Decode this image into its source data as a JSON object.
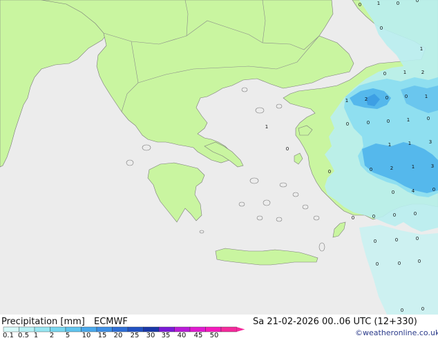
{
  "map": {
    "colors": {
      "sea": "#ececec",
      "land": "#c9f5a0",
      "border": "#8a8a8a",
      "coast": "#6a6a6a",
      "precip_light": "#b9eef0",
      "precip_mid": "#8fdff0",
      "precip_heavy": "#55b8ec"
    },
    "point_values": [
      {
        "v": "0"
      },
      {
        "v": "1"
      },
      {
        "v": "0"
      },
      {
        "v": "0"
      },
      {
        "v": "0"
      },
      {
        "v": "1"
      },
      {
        "v": "0"
      },
      {
        "v": "1"
      },
      {
        "v": "2"
      },
      {
        "v": "1"
      },
      {
        "v": "2"
      },
      {
        "v": "0"
      },
      {
        "v": "0"
      },
      {
        "v": "1"
      },
      {
        "v": "1"
      },
      {
        "v": "0"
      },
      {
        "v": "0"
      },
      {
        "v": "0"
      },
      {
        "v": "1"
      },
      {
        "v": "0"
      },
      {
        "v": "0"
      },
      {
        "v": "1"
      },
      {
        "v": "1"
      },
      {
        "v": "3"
      },
      {
        "v": "0"
      },
      {
        "v": "0"
      },
      {
        "v": "2"
      },
      {
        "v": "1"
      },
      {
        "v": "3"
      },
      {
        "v": "0"
      },
      {
        "v": "4"
      },
      {
        "v": "0"
      },
      {
        "v": "0"
      },
      {
        "v": "0"
      },
      {
        "v": "0"
      },
      {
        "v": "0"
      },
      {
        "v": "0"
      },
      {
        "v": "0"
      },
      {
        "v": "0"
      },
      {
        "v": "0"
      },
      {
        "v": "0"
      },
      {
        "v": "0"
      },
      {
        "v": "0"
      },
      {
        "v": "0"
      }
    ]
  },
  "footer": {
    "title": "Precipitation [mm]",
    "model": "ECMWF",
    "datetime": "Sa 21-02-2026 00..06 UTC (12+330)",
    "credit": "©weatheronline.co.uk"
  },
  "legend": {
    "ticks": [
      "0.1",
      "0.5",
      "1",
      "2",
      "5",
      "10",
      "15",
      "20",
      "25",
      "30",
      "35",
      "40",
      "45",
      "50"
    ],
    "colors": [
      "#d6fafa",
      "#b6f1f5",
      "#97e6f2",
      "#77d6ef",
      "#5fc4ee",
      "#4aa9ec",
      "#3d8fe6",
      "#2f6fd6",
      "#2352c2",
      "#1a37a8",
      "#7a1bd6",
      "#b91bd8",
      "#e01bd0",
      "#f51bbd",
      "#f42a9c"
    ]
  }
}
